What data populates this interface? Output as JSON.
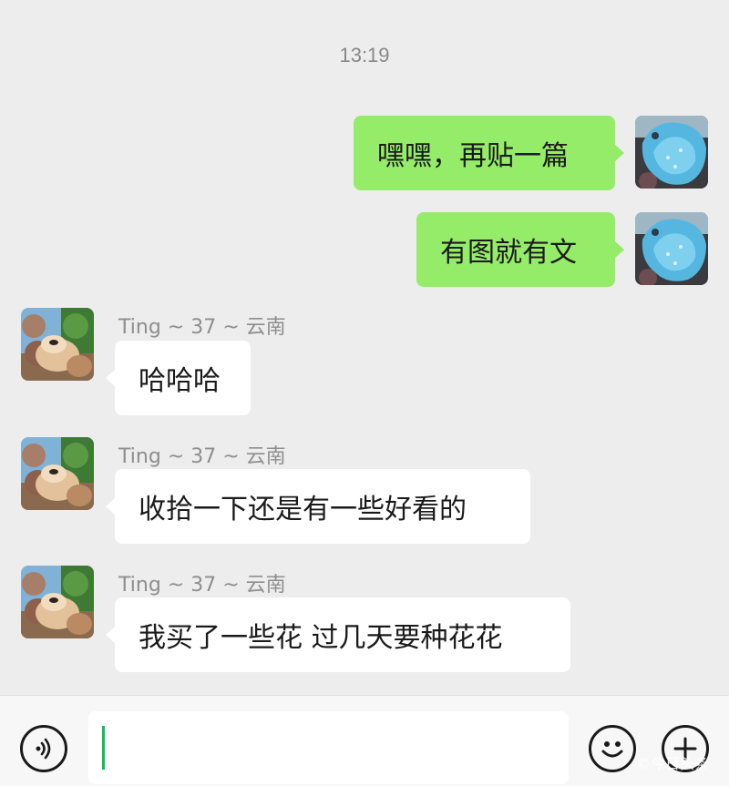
{
  "chat": {
    "timestamp": "13:19",
    "messages": [
      {
        "direction": "out",
        "text": "嘿嘿，再贴一篇"
      },
      {
        "direction": "out",
        "text": "有图就有文"
      },
      {
        "direction": "in",
        "sender": "Ting  ~ 37 ~ 云南",
        "text": "哈哈哈"
      },
      {
        "direction": "in",
        "sender": "Ting  ~ 37 ~ 云南",
        "text": "收拾一下还是有一些好看的"
      },
      {
        "direction": "in",
        "sender": "Ting  ~ 37 ~ 云南",
        "text": "我买了一些花 过几天要种花花"
      }
    ]
  },
  "input_bar": {
    "input_value": "",
    "voice_icon": "voice-wave-icon",
    "emoji_icon": "emoji-icon",
    "plus_icon": "plus-icon",
    "watermark": "©今日头条"
  },
  "colors": {
    "background": "#ededed",
    "outgoing_bubble": "#95ec69",
    "incoming_bubble": "#ffffff",
    "caret": "#07c160"
  }
}
